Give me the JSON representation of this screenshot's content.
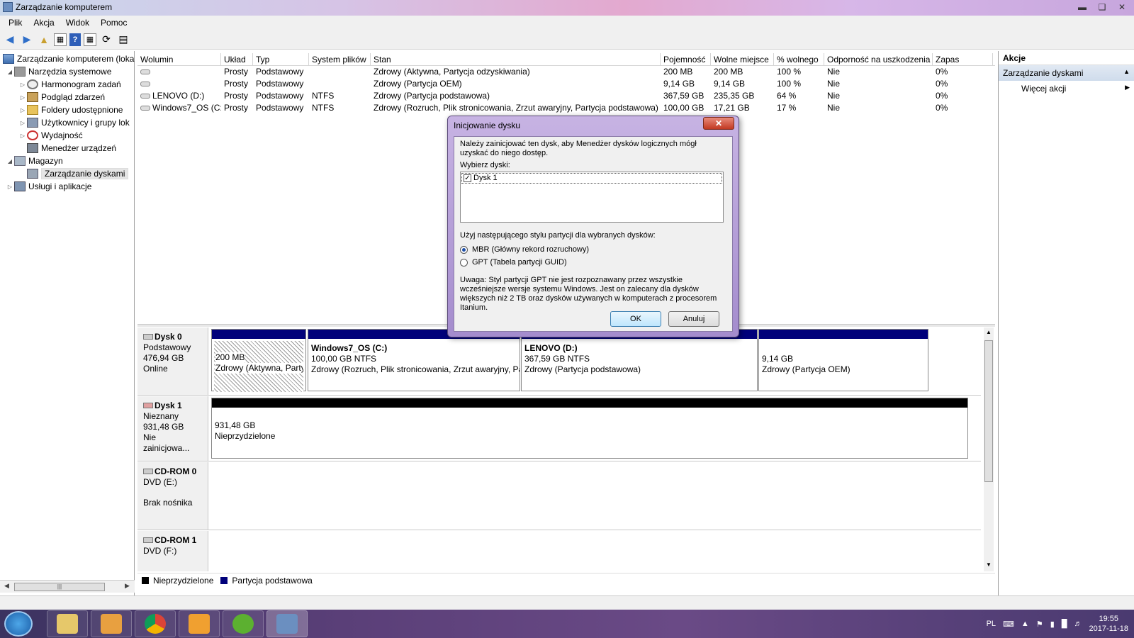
{
  "window": {
    "title": "Zarządzanie komputerem"
  },
  "menu": [
    "Plik",
    "Akcja",
    "Widok",
    "Pomoc"
  ],
  "tree": {
    "root": "Zarządzanie komputerem (loka",
    "system_tools": "Narzędzia systemowe",
    "items": [
      "Harmonogram zadań",
      "Podgląd zdarzeń",
      "Foldery udostępnione",
      "Użytkownicy i grupy lok",
      "Wydajność",
      "Menedżer urządzeń"
    ],
    "storage": "Magazyn",
    "disk_mgmt": "Zarządzanie dyskami",
    "services": "Usługi i aplikacje"
  },
  "volumes": {
    "headers": [
      "Wolumin",
      "Układ",
      "Typ",
      "System plików",
      "Stan",
      "Pojemność",
      "Wolne miejsce",
      "% wolnego",
      "Odporność na uszkodzenia",
      "Zapas"
    ],
    "rows": [
      [
        "",
        "Prosty",
        "Podstawowy",
        "",
        "Zdrowy (Aktywna, Partycja odzyskiwania)",
        "200 MB",
        "200 MB",
        "100 %",
        "Nie",
        "0%"
      ],
      [
        "",
        "Prosty",
        "Podstawowy",
        "",
        "Zdrowy (Partycja OEM)",
        "9,14 GB",
        "9,14 GB",
        "100 %",
        "Nie",
        "0%"
      ],
      [
        "LENOVO (D:)",
        "Prosty",
        "Podstawowy",
        "NTFS",
        "Zdrowy (Partycja podstawowa)",
        "367,59 GB",
        "235,35 GB",
        "64 %",
        "Nie",
        "0%"
      ],
      [
        "Windows7_OS (C:)",
        "Prosty",
        "Podstawowy",
        "NTFS",
        "Zdrowy (Rozruch, Plik stronicowania, Zrzut awaryjny, Partycja podstawowa)",
        "100,00 GB",
        "17,21 GB",
        "17 %",
        "Nie",
        "0%"
      ]
    ]
  },
  "disks": {
    "disk0": {
      "name": "Dysk 0",
      "type": "Podstawowy",
      "size": "476,94 GB",
      "status": "Online",
      "p1": {
        "size": "200 MB",
        "state": "Zdrowy (Aktywna, Party"
      },
      "p2": {
        "name": "Windows7_OS  (C:)",
        "size": "100,00 GB NTFS",
        "state": "Zdrowy (Rozruch, Plik stronicowania, Zrzut awaryjny, Pa"
      },
      "p3": {
        "name": "LENOVO  (D:)",
        "size": "367,59 GB NTFS",
        "state": "Zdrowy (Partycja podstawowa)"
      },
      "p4": {
        "size": "9,14 GB",
        "state": "Zdrowy (Partycja OEM)"
      }
    },
    "disk1": {
      "name": "Dysk 1",
      "type": "Nieznany",
      "size": "931,48 GB",
      "status": "Nie zainicjowa...",
      "unalloc_size": "931,48 GB",
      "unalloc_label": "Nieprzydzielone"
    },
    "cdrom0": {
      "name": "CD-ROM 0",
      "type": "DVD (E:)",
      "status": "Brak nośnika"
    },
    "cdrom1": {
      "name": "CD-ROM 1",
      "type": "DVD (F:)"
    }
  },
  "legend": {
    "unallocated": "Nieprzydzielone",
    "primary": "Partycja podstawowa"
  },
  "actions": {
    "header": "Akcje",
    "section": "Zarządzanie dyskami",
    "more": "Więcej akcji"
  },
  "dialog": {
    "title": "Inicjowanie dysku",
    "intro": "Należy zainicjować ten dysk, aby Menedżer dysków logicznych mógł uzyskać do niego dostęp.",
    "select_label": "Wybierz dyski:",
    "disk_item": "Dysk 1",
    "style_label": "Użyj następującego stylu partycji dla wybranych dysków:",
    "mbr": "MBR (Główny rekord rozruchowy)",
    "gpt": "GPT (Tabela partycji GUID)",
    "note": "Uwaga: Styl partycji GPT nie jest rozpoznawany przez wszystkie wcześniejsze wersje systemu Windows. Jest on zalecany dla dysków większych niż 2 TB oraz dysków używanych w komputerach z procesorem Itanium.",
    "ok": "OK",
    "cancel": "Anuluj"
  },
  "taskbar": {
    "lang": "PL",
    "time": "19:55",
    "date": "2017-11-18"
  },
  "colors": {
    "primary_partition": "#00007a",
    "unallocated": "#000000",
    "accent": "#3c7fb1"
  }
}
